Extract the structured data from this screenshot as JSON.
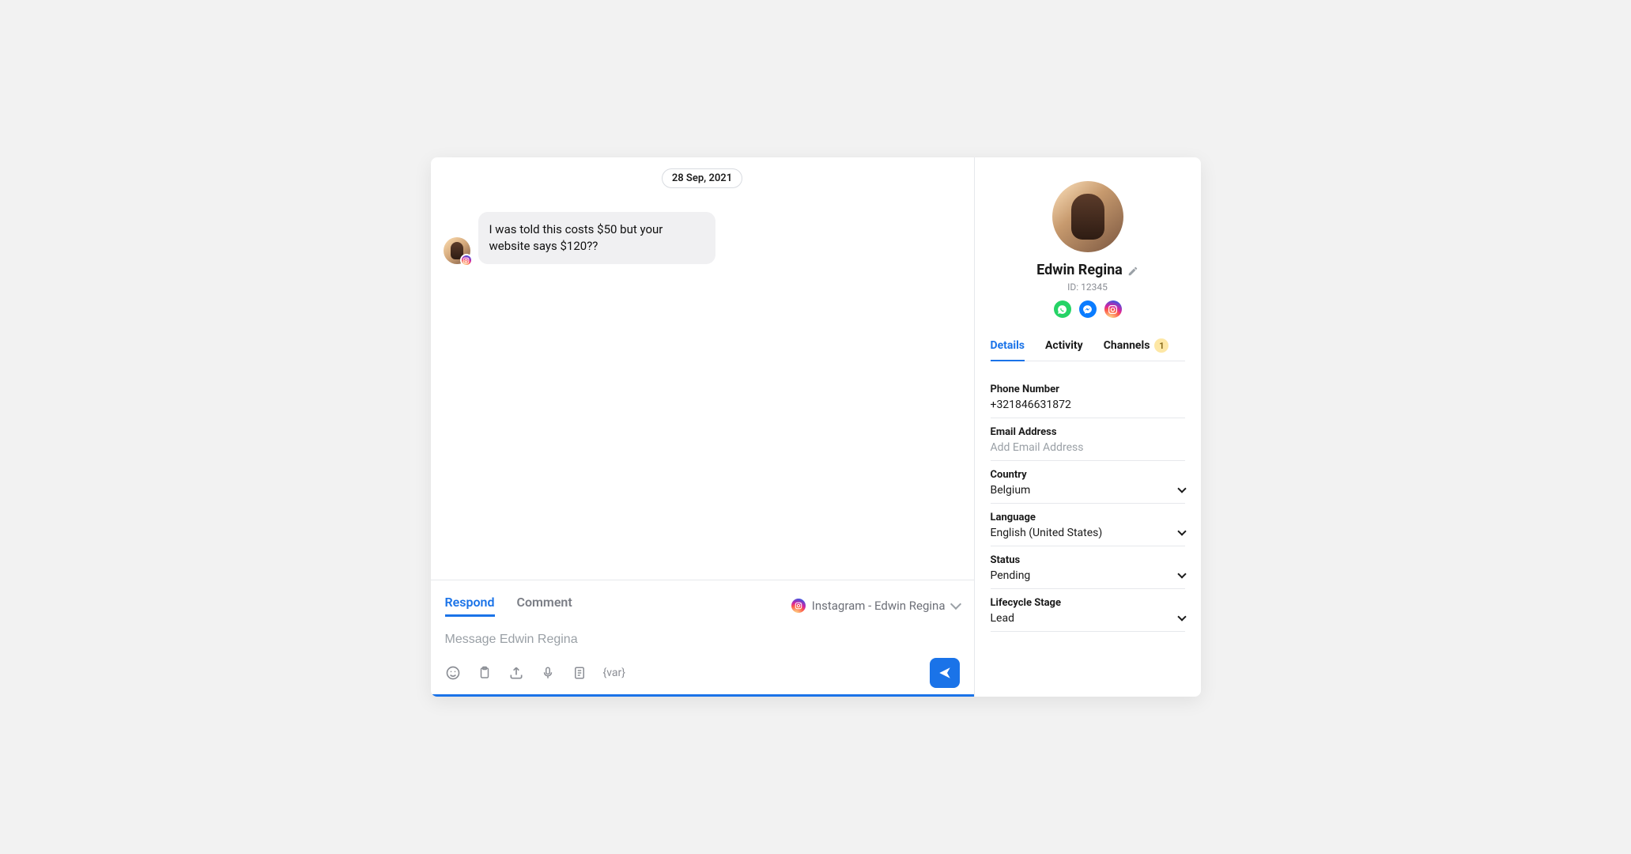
{
  "chat": {
    "date": "28 Sep, 2021",
    "message": "I was told this costs $50 but your website says $120??"
  },
  "composer": {
    "tab_respond": "Respond",
    "tab_comment": "Comment",
    "channel_label": "Instagram - Edwin Regina",
    "placeholder": "Message Edwin Regina",
    "var_label": "{var}"
  },
  "profile": {
    "name": "Edwin Regina",
    "id_label": "ID: 12345",
    "tabs": {
      "details": "Details",
      "activity": "Activity",
      "channels": "Channels",
      "channels_badge": "1"
    },
    "fields": {
      "phone_label": "Phone Number",
      "phone_value": "+321846631872",
      "email_label": "Email Address",
      "email_placeholder": "Add Email Address",
      "country_label": "Country",
      "country_value": "Belgium",
      "language_label": "Language",
      "language_value": "English (United States)",
      "status_label": "Status",
      "status_value": "Pending",
      "lifecycle_label": "Lifecycle Stage",
      "lifecycle_value": "Lead"
    }
  }
}
